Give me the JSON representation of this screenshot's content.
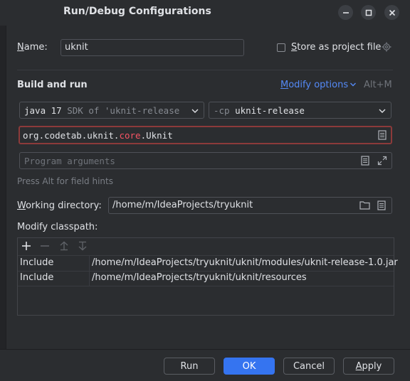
{
  "window": {
    "title": "Run/Debug Configurations"
  },
  "name_row": {
    "label": "Name:",
    "value": "uknit",
    "store_label": "Store as project file"
  },
  "build": {
    "heading": "Build and run",
    "modify_options": "Modify options",
    "modify_shortcut": "Alt+M",
    "jdk_bold": "java 17",
    "jdk_rest": "SDK of 'uknit-release",
    "cp_prefix": "-cp",
    "cp_value": "uknit-release",
    "main_class": {
      "pre": "org.codetab.uknit.",
      "highlight": "core",
      "post": ".Uknit"
    },
    "program_args_placeholder": "Program arguments",
    "hint": "Press Alt for field hints"
  },
  "workdir": {
    "label": "Working directory:",
    "value": "/home/m/IdeaProjects/tryuknit"
  },
  "classpath": {
    "label": "Modify classpath:",
    "rows": [
      {
        "type": "Include",
        "path": "/home/m/IdeaProjects/tryuknit/uknit/modules/uknit-release-1.0.jar"
      },
      {
        "type": "Include",
        "path": "/home/m/IdeaProjects/tryuknit/uknit/resources"
      }
    ]
  },
  "buttons": {
    "run": "Run",
    "ok": "OK",
    "cancel": "Cancel",
    "apply": "Apply"
  },
  "colors": {
    "accent": "#3574f0",
    "link": "#548af7",
    "error_border": "#8c3a3a",
    "keyword": "#f75464"
  }
}
